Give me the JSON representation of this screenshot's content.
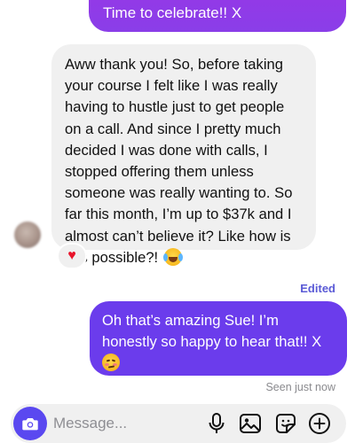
{
  "messages": {
    "sent_top": {
      "line_partial": "Time to celebrate!! X",
      "line_full": "Time to celebrate!! X"
    },
    "received": {
      "text": "Aww thank you! So, before taking your course I felt like I was really having to hustle just to get people on a call. And since  I pretty much decided I was done with calls, I stopped offering them unless someone was really wanting to. So far this month, I’m up to $37k and I almost can’t believe it? Like how is this possible?!",
      "emoji": "face-with-tears-of-joy",
      "reaction": "♥"
    },
    "edited_label": "Edited",
    "sent": {
      "text": "Oh that’s amazing Sue! I’m honestly so happy to hear that!! X",
      "emoji": "woozy-face"
    },
    "seen_status": "Seen just now"
  },
  "composer": {
    "placeholder": "Message...",
    "icons": [
      "camera-icon",
      "microphone-icon",
      "gallery-icon",
      "sticker-icon",
      "plus-circle-icon"
    ]
  },
  "colors": {
    "sent_bubble": "#6b3cec",
    "sent_bubble_top": "#9b35e6",
    "received_bubble": "#f0f0f0",
    "edited_label": "#5a5ad6",
    "camera_button": "#5a48f0",
    "heart": "#e8142b"
  }
}
